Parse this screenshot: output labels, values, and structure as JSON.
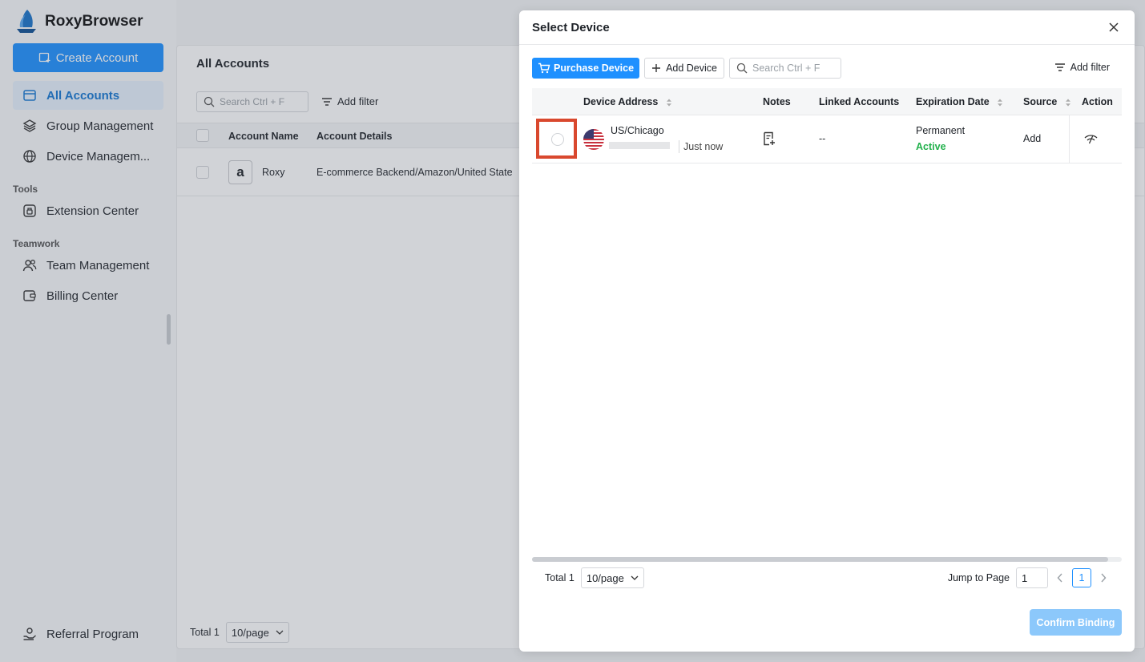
{
  "app": {
    "name": "RoxyBrowser"
  },
  "sidebar": {
    "create_label": "Create Account",
    "items": [
      {
        "label": "All Accounts"
      },
      {
        "label": "Group Management"
      },
      {
        "label": "Device Managem..."
      }
    ],
    "tools_section": "Tools",
    "tools_items": [
      {
        "label": "Extension Center"
      }
    ],
    "teamwork_section": "Teamwork",
    "teamwork_items": [
      {
        "label": "Team Management"
      },
      {
        "label": "Billing Center"
      }
    ],
    "referral_label": "Referral Program"
  },
  "main": {
    "title": "All Accounts",
    "search_placeholder": "Search Ctrl + F",
    "filter_label": "Add filter",
    "columns": [
      "Account Name",
      "Account Details"
    ],
    "rows": [
      {
        "name": "Roxy",
        "details": "E-commerce Backend/Amazon/United State",
        "icon": "a"
      }
    ],
    "total_label": "Total 1",
    "page_size": "10/page"
  },
  "drawer": {
    "title": "Select Device",
    "purchase_label": "Purchase Device",
    "add_device_label": "Add Device",
    "search_placeholder": "Search Ctrl + F",
    "filter_label": "Add filter",
    "columns": {
      "address": "Device Address",
      "notes": "Notes",
      "linked": "Linked Accounts",
      "expiration": "Expiration Date",
      "source": "Source",
      "action": "Action"
    },
    "rows": [
      {
        "location": "US/Chicago",
        "time": "Just now",
        "linked": "--",
        "expiration": "Permanent",
        "status": "Active",
        "source": "Add"
      }
    ],
    "total_label": "Total 1",
    "page_size": "10/page",
    "jump_label": "Jump to Page",
    "jump_value": "1",
    "current_page": "1",
    "confirm_label": "Confirm Binding"
  },
  "colors": {
    "accent": "#1e90ff",
    "active_status": "#22b14c",
    "highlight": "#d9482e"
  }
}
